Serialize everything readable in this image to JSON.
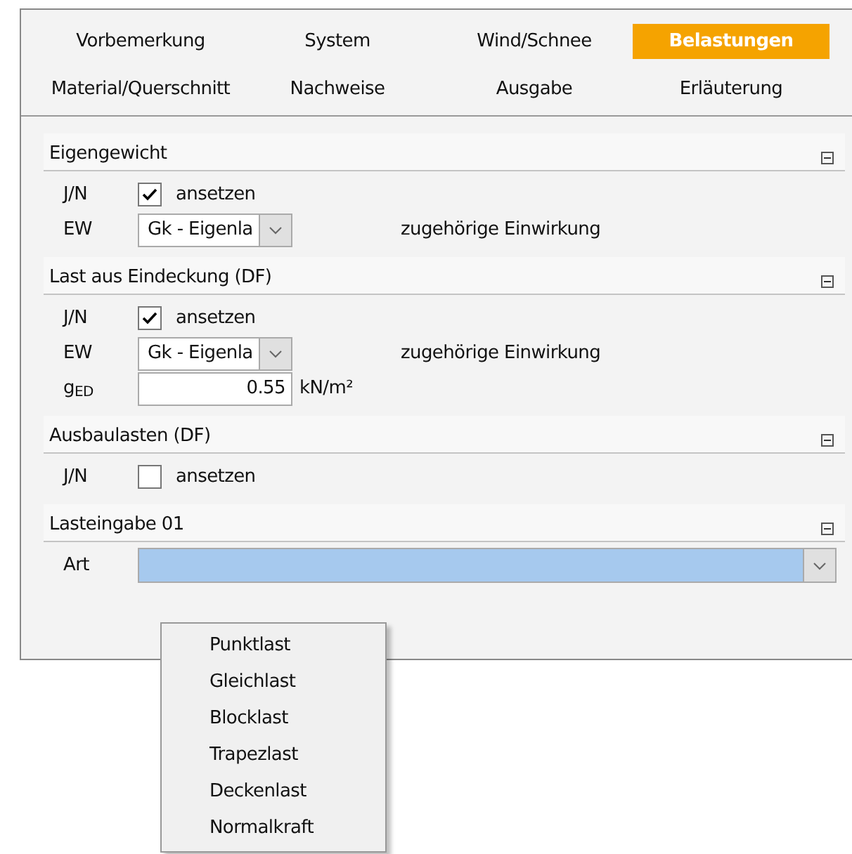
{
  "tabs": [
    {
      "label": "Vorbemerkung",
      "selected": false
    },
    {
      "label": "System",
      "selected": false
    },
    {
      "label": "Wind/Schnee",
      "selected": false
    },
    {
      "label": "Belastungen",
      "selected": true
    },
    {
      "label": "Material/Querschnitt",
      "selected": false
    },
    {
      "label": "Nachweise",
      "selected": false
    },
    {
      "label": "Ausgabe",
      "selected": false
    },
    {
      "label": "Erläuterung",
      "selected": false
    }
  ],
  "sections": [
    {
      "title": "Eigengewicht",
      "expanded": true,
      "rows": [
        {
          "kind": "checkbox",
          "label": "J/N",
          "checked": true,
          "text": "ansetzen"
        },
        {
          "kind": "select",
          "label": "EW",
          "value": "Gk - Eigenla",
          "note": "zugehörige Einwirkung"
        }
      ]
    },
    {
      "title": "Last aus Eindeckung (DF)",
      "expanded": true,
      "rows": [
        {
          "kind": "checkbox",
          "label": "J/N",
          "checked": true,
          "text": "ansetzen"
        },
        {
          "kind": "select",
          "label": "EW",
          "value": "Gk - Eigenla",
          "note": "zugehörige Einwirkung"
        },
        {
          "kind": "number",
          "label": "g$_{ED}$",
          "value": "0.55",
          "unit": "kN/m²"
        }
      ]
    },
    {
      "title": "Ausbaulasten (DF)",
      "expanded": true,
      "rows": [
        {
          "kind": "checkbox",
          "label": "J/N",
          "checked": false,
          "text": "ansetzen"
        }
      ]
    },
    {
      "title": "Lasteingabe 01",
      "expanded": true,
      "rows": [
        {
          "kind": "wideselect",
          "label": "Art",
          "focused": true
        }
      ]
    }
  ],
  "dropdown": {
    "open": true,
    "options": [
      "Punktlast",
      "Gleichlast",
      "Blocklast",
      "Trapezlast",
      "Deckenlast",
      "Normalkraft"
    ]
  }
}
